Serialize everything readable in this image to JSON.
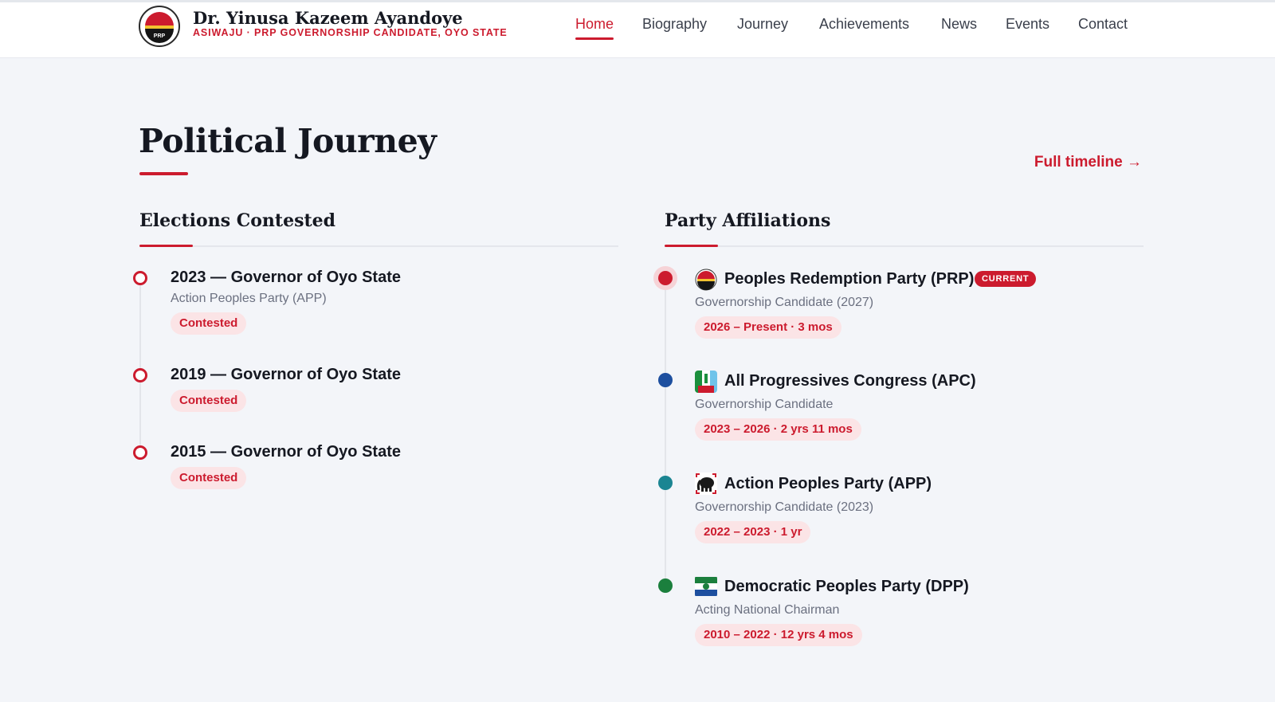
{
  "brand": {
    "name": "Dr. Yinusa Kazeem Ayandoye",
    "subtitle": "ASIWAJU · PRP GOVERNORSHIP CANDIDATE, OYO STATE",
    "logo_text": "PRP"
  },
  "nav": [
    {
      "label": "Home",
      "active": true
    },
    {
      "label": "Biography",
      "active": false
    },
    {
      "label": "Journey",
      "active": false
    },
    {
      "label": "Achievements",
      "active": false
    },
    {
      "label": "News",
      "active": false
    },
    {
      "label": "Events",
      "active": false
    },
    {
      "label": "Contact",
      "active": false
    }
  ],
  "section": {
    "title": "Political Journey",
    "full_timeline_label": "Full timeline →"
  },
  "elections": {
    "heading": "Elections Contested",
    "items": [
      {
        "title": "2023 — Governor of Oyo State",
        "party": "Action Peoples Party (APP)",
        "status": "Contested"
      },
      {
        "title": "2019 — Governor of Oyo State",
        "status": "Contested"
      },
      {
        "title": "2015 — Governor of Oyo State",
        "status": "Contested"
      }
    ]
  },
  "affiliations": {
    "heading": "Party Affiliations",
    "items": [
      {
        "name": "Peoples Redemption Party (PRP)",
        "badge": "CURRENT",
        "role": "Governorship Candidate (2027)",
        "period": "2026 – Present · 3 mos",
        "dot_color": "#cc1b2e",
        "icon": "prp-logo-icon"
      },
      {
        "name": "All Progressives Congress (APC)",
        "role": "Governorship Candidate",
        "period": "2023 – 2026 · 2 yrs 11 mos",
        "dot_color": "#1d4f9f",
        "icon": "apc-logo-icon"
      },
      {
        "name": "Action Peoples Party (APP)",
        "role": "Governorship Candidate (2023)",
        "period": "2022 – 2023 · 1 yr",
        "dot_color": "#1b8592",
        "icon": "app-elephant-icon"
      },
      {
        "name": "Democratic Peoples Party (DPP)",
        "role": "Acting National Chairman",
        "period": "2010 – 2022 · 12 yrs 4 mos",
        "dot_color": "#1b7f3d",
        "icon": "dpp-flag-icon"
      }
    ]
  },
  "colors": {
    "accent": "#cc1b2e",
    "text": "#151821",
    "muted": "#6b7080",
    "background": "#f3f5f9"
  }
}
